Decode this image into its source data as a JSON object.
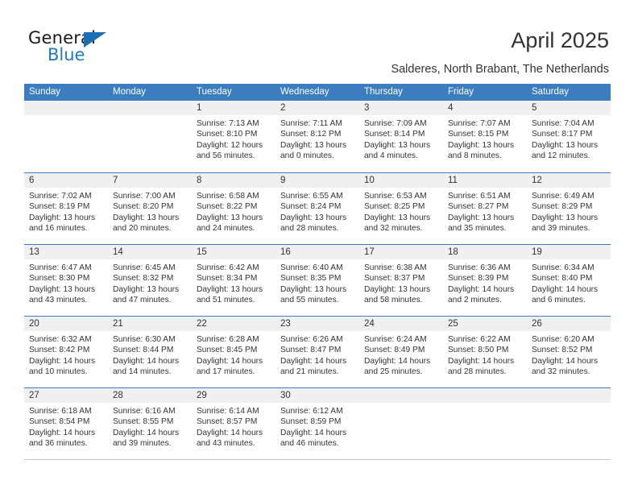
{
  "brand": {
    "name_part1": "General",
    "name_part2": "Blue",
    "triangle_icon": "triangle-icon",
    "accent_color": "#1a7bc4"
  },
  "header": {
    "title": "April 2025",
    "subtitle": "Salderes, North Brabant, The Netherlands"
  },
  "calendar": {
    "header_bg_color": "#3b7dbf",
    "day_strip_color": "#f0f0f0",
    "weekdays": [
      "Sunday",
      "Monday",
      "Tuesday",
      "Wednesday",
      "Thursday",
      "Friday",
      "Saturday"
    ],
    "weeks": [
      [
        {
          "day": "",
          "empty": true
        },
        {
          "day": "",
          "empty": true
        },
        {
          "day": "1",
          "sunrise": "Sunrise: 7:13 AM",
          "sunset": "Sunset: 8:10 PM",
          "daylight": "Daylight: 12 hours and 56 minutes."
        },
        {
          "day": "2",
          "sunrise": "Sunrise: 7:11 AM",
          "sunset": "Sunset: 8:12 PM",
          "daylight": "Daylight: 13 hours and 0 minutes."
        },
        {
          "day": "3",
          "sunrise": "Sunrise: 7:09 AM",
          "sunset": "Sunset: 8:14 PM",
          "daylight": "Daylight: 13 hours and 4 minutes."
        },
        {
          "day": "4",
          "sunrise": "Sunrise: 7:07 AM",
          "sunset": "Sunset: 8:15 PM",
          "daylight": "Daylight: 13 hours and 8 minutes."
        },
        {
          "day": "5",
          "sunrise": "Sunrise: 7:04 AM",
          "sunset": "Sunset: 8:17 PM",
          "daylight": "Daylight: 13 hours and 12 minutes."
        }
      ],
      [
        {
          "day": "6",
          "sunrise": "Sunrise: 7:02 AM",
          "sunset": "Sunset: 8:19 PM",
          "daylight": "Daylight: 13 hours and 16 minutes."
        },
        {
          "day": "7",
          "sunrise": "Sunrise: 7:00 AM",
          "sunset": "Sunset: 8:20 PM",
          "daylight": "Daylight: 13 hours and 20 minutes."
        },
        {
          "day": "8",
          "sunrise": "Sunrise: 6:58 AM",
          "sunset": "Sunset: 8:22 PM",
          "daylight": "Daylight: 13 hours and 24 minutes."
        },
        {
          "day": "9",
          "sunrise": "Sunrise: 6:55 AM",
          "sunset": "Sunset: 8:24 PM",
          "daylight": "Daylight: 13 hours and 28 minutes."
        },
        {
          "day": "10",
          "sunrise": "Sunrise: 6:53 AM",
          "sunset": "Sunset: 8:25 PM",
          "daylight": "Daylight: 13 hours and 32 minutes."
        },
        {
          "day": "11",
          "sunrise": "Sunrise: 6:51 AM",
          "sunset": "Sunset: 8:27 PM",
          "daylight": "Daylight: 13 hours and 35 minutes."
        },
        {
          "day": "12",
          "sunrise": "Sunrise: 6:49 AM",
          "sunset": "Sunset: 8:29 PM",
          "daylight": "Daylight: 13 hours and 39 minutes."
        }
      ],
      [
        {
          "day": "13",
          "sunrise": "Sunrise: 6:47 AM",
          "sunset": "Sunset: 8:30 PM",
          "daylight": "Daylight: 13 hours and 43 minutes."
        },
        {
          "day": "14",
          "sunrise": "Sunrise: 6:45 AM",
          "sunset": "Sunset: 8:32 PM",
          "daylight": "Daylight: 13 hours and 47 minutes."
        },
        {
          "day": "15",
          "sunrise": "Sunrise: 6:42 AM",
          "sunset": "Sunset: 8:34 PM",
          "daylight": "Daylight: 13 hours and 51 minutes."
        },
        {
          "day": "16",
          "sunrise": "Sunrise: 6:40 AM",
          "sunset": "Sunset: 8:35 PM",
          "daylight": "Daylight: 13 hours and 55 minutes."
        },
        {
          "day": "17",
          "sunrise": "Sunrise: 6:38 AM",
          "sunset": "Sunset: 8:37 PM",
          "daylight": "Daylight: 13 hours and 58 minutes."
        },
        {
          "day": "18",
          "sunrise": "Sunrise: 6:36 AM",
          "sunset": "Sunset: 8:39 PM",
          "daylight": "Daylight: 14 hours and 2 minutes."
        },
        {
          "day": "19",
          "sunrise": "Sunrise: 6:34 AM",
          "sunset": "Sunset: 8:40 PM",
          "daylight": "Daylight: 14 hours and 6 minutes."
        }
      ],
      [
        {
          "day": "20",
          "sunrise": "Sunrise: 6:32 AM",
          "sunset": "Sunset: 8:42 PM",
          "daylight": "Daylight: 14 hours and 10 minutes."
        },
        {
          "day": "21",
          "sunrise": "Sunrise: 6:30 AM",
          "sunset": "Sunset: 8:44 PM",
          "daylight": "Daylight: 14 hours and 14 minutes."
        },
        {
          "day": "22",
          "sunrise": "Sunrise: 6:28 AM",
          "sunset": "Sunset: 8:45 PM",
          "daylight": "Daylight: 14 hours and 17 minutes."
        },
        {
          "day": "23",
          "sunrise": "Sunrise: 6:26 AM",
          "sunset": "Sunset: 8:47 PM",
          "daylight": "Daylight: 14 hours and 21 minutes."
        },
        {
          "day": "24",
          "sunrise": "Sunrise: 6:24 AM",
          "sunset": "Sunset: 8:49 PM",
          "daylight": "Daylight: 14 hours and 25 minutes."
        },
        {
          "day": "25",
          "sunrise": "Sunrise: 6:22 AM",
          "sunset": "Sunset: 8:50 PM",
          "daylight": "Daylight: 14 hours and 28 minutes."
        },
        {
          "day": "26",
          "sunrise": "Sunrise: 6:20 AM",
          "sunset": "Sunset: 8:52 PM",
          "daylight": "Daylight: 14 hours and 32 minutes."
        }
      ],
      [
        {
          "day": "27",
          "sunrise": "Sunrise: 6:18 AM",
          "sunset": "Sunset: 8:54 PM",
          "daylight": "Daylight: 14 hours and 36 minutes."
        },
        {
          "day": "28",
          "sunrise": "Sunrise: 6:16 AM",
          "sunset": "Sunset: 8:55 PM",
          "daylight": "Daylight: 14 hours and 39 minutes."
        },
        {
          "day": "29",
          "sunrise": "Sunrise: 6:14 AM",
          "sunset": "Sunset: 8:57 PM",
          "daylight": "Daylight: 14 hours and 43 minutes."
        },
        {
          "day": "30",
          "sunrise": "Sunrise: 6:12 AM",
          "sunset": "Sunset: 8:59 PM",
          "daylight": "Daylight: 14 hours and 46 minutes."
        },
        {
          "day": "",
          "empty": true
        },
        {
          "day": "",
          "empty": true
        },
        {
          "day": "",
          "empty": true
        }
      ]
    ]
  }
}
